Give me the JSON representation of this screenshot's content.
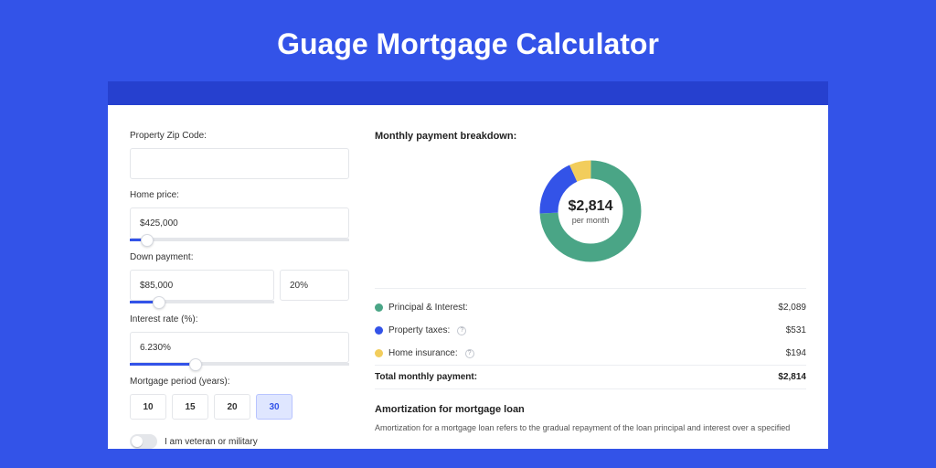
{
  "header": {
    "title": "Guage Mortgage Calculator"
  },
  "form": {
    "zip": {
      "label": "Property Zip Code:",
      "value": ""
    },
    "home_price": {
      "label": "Home price:",
      "value": "$425,000",
      "slider_pct": 8
    },
    "down_payment": {
      "label": "Down payment:",
      "amount": "$85,000",
      "percent": "20%",
      "slider_pct": 20
    },
    "interest_rate": {
      "label": "Interest rate (%):",
      "value": "6.230%",
      "slider_pct": 30
    },
    "period": {
      "label": "Mortgage period (years):",
      "options": [
        "10",
        "15",
        "20",
        "30"
      ],
      "selected": "30"
    },
    "veteran": {
      "label": "I am veteran or military",
      "on": false
    }
  },
  "chart_data": {
    "type": "pie",
    "title": "Monthly payment breakdown:",
    "center_value": "$2,814",
    "center_sub": "per month",
    "series": [
      {
        "name": "Principal & Interest:",
        "value": 2089,
        "display": "$2,089",
        "color": "#4aa586"
      },
      {
        "name": "Property taxes:",
        "value": 531,
        "display": "$531",
        "color": "#3353e8",
        "info": true
      },
      {
        "name": "Home insurance:",
        "value": 194,
        "display": "$194",
        "color": "#f2cd5c",
        "info": true
      }
    ],
    "total_label": "Total monthly payment:",
    "total_value": "$2,814"
  },
  "amortization": {
    "title": "Amortization for mortgage loan",
    "body": "Amortization for a mortgage loan refers to the gradual repayment of the loan principal and interest over a specified"
  }
}
